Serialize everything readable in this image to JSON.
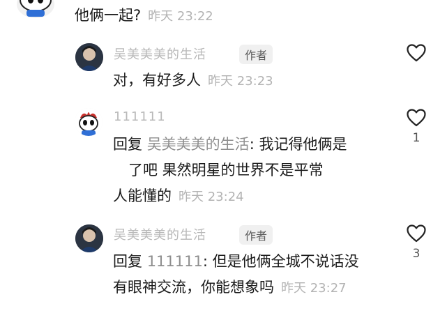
{
  "comments": [
    {
      "text": "他俩一起?",
      "time": "昨天 23:22"
    },
    {
      "name": "吴美美美的生活",
      "tag": "作者",
      "text": "对，有好多人",
      "time": "昨天 23:23",
      "like_count": ""
    },
    {
      "name": "111111",
      "reply_word": "回复",
      "mention": "吴美美美的生活",
      "line1": ": 我记得他俩是",
      "line2": "了吧 果然明星的世界不是平常",
      "line3": "人能懂的",
      "time": "昨天 23:24",
      "like_count": "1"
    },
    {
      "name": "吴美美美的生活",
      "tag": "作者",
      "reply_word": "回复",
      "mention": "111111",
      "line1": ": 但是他俩全城不说话没",
      "line2": "有眼神交流，你能想象吗",
      "time": "昨天 23:27",
      "like_count": "3"
    }
  ],
  "icons": {
    "like": "heart-outline-icon"
  }
}
